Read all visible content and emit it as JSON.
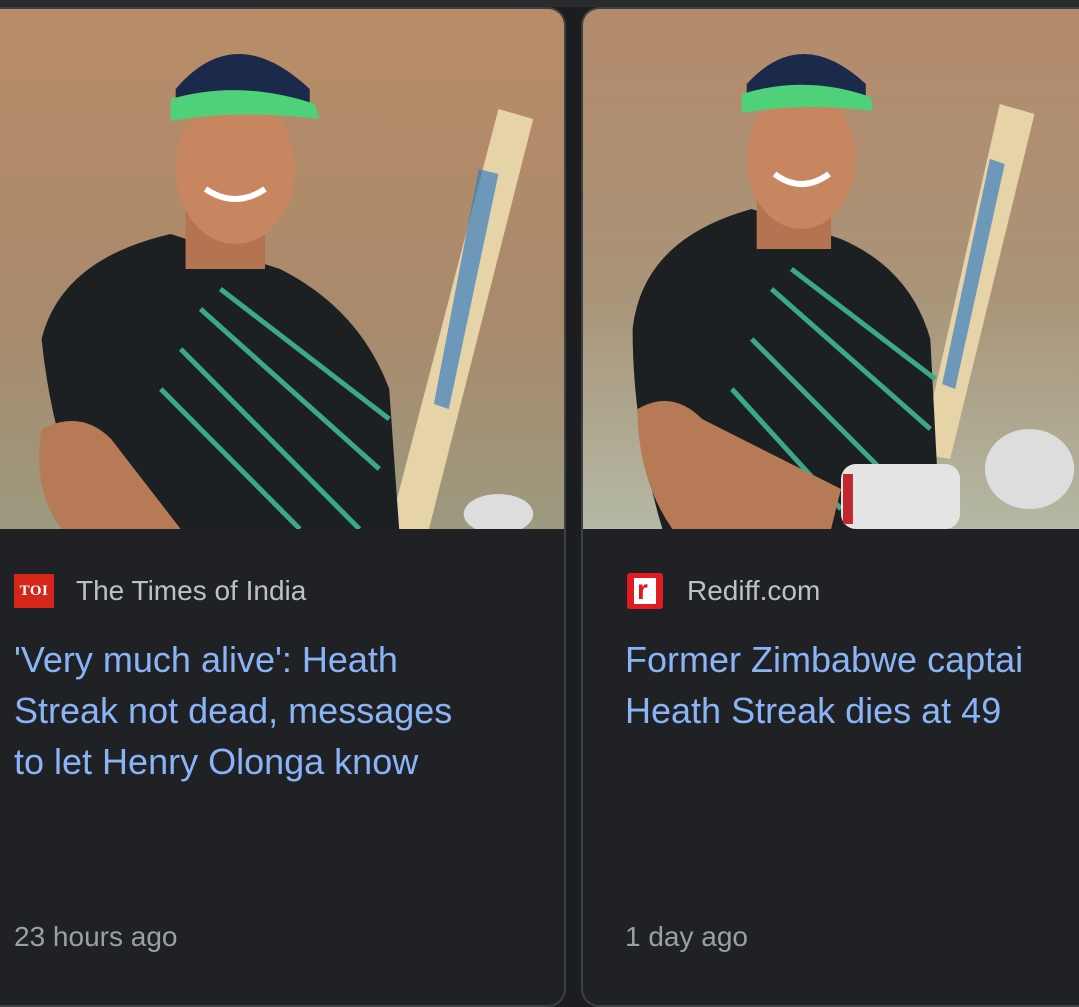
{
  "cards": [
    {
      "source": "The Times of India",
      "source_logo_text": "TOI",
      "headline": "'Very much alive': Heath\nStreak not dead, messages\nto let Henry Olonga know",
      "time": "23 hours ago",
      "thumbnail": "cricketer-photo"
    },
    {
      "source": "Rediff.com",
      "source_logo_text": "r",
      "headline": "Former Zimbabwe captai\nHeath Streak dies at 49",
      "time": "1 day ago",
      "thumbnail": "cricketer-photo"
    }
  ],
  "colors": {
    "background": "#202124",
    "headline": "#8ab4f8",
    "source_text": "#bdc1c6",
    "time_text": "#9aa0a6",
    "toi_red": "#d6261c",
    "rediff_red": "#e21b23"
  }
}
